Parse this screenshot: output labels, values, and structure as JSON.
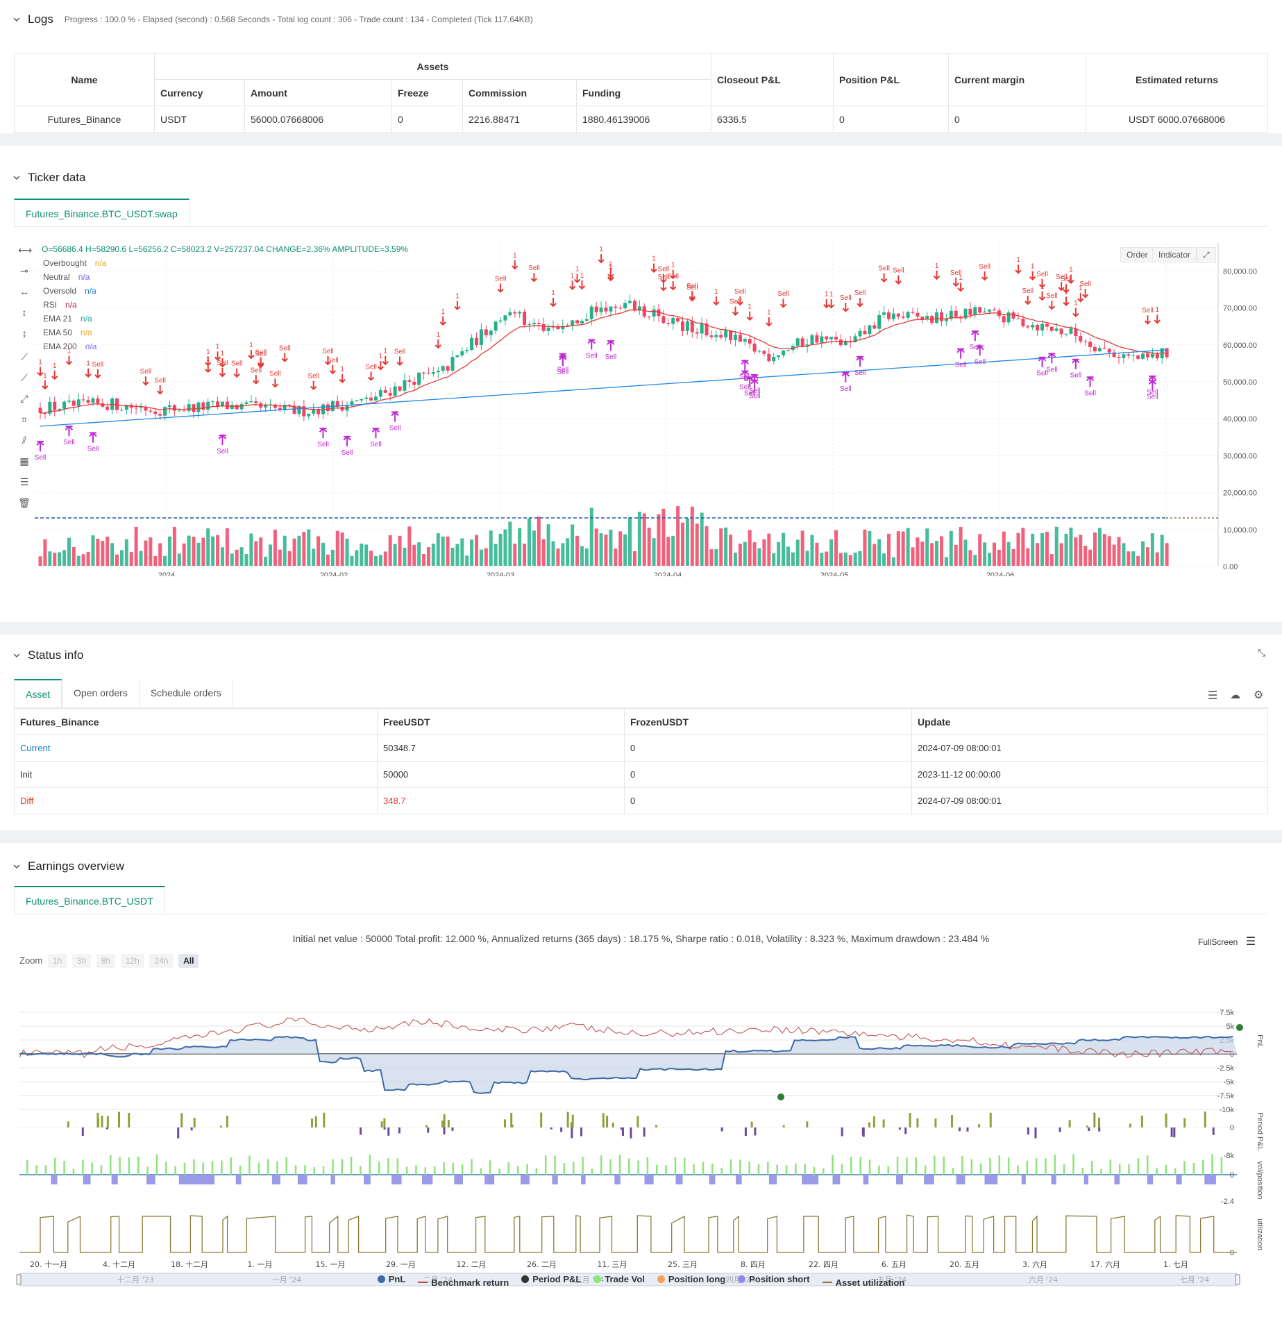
{
  "logs": {
    "title": "Logs",
    "info": "Progress : 100.0 % - Elapsed (second) : 0.568  Seconds - Total log count : 306 - Trade count : 134 - Completed (Tick 117.64KB)"
  },
  "assets_table": {
    "group_header": "Assets",
    "headers": [
      "Name",
      "Currency",
      "Amount",
      "Freeze",
      "Commission",
      "Funding",
      "Closeout P&L",
      "Position P&L",
      "Current margin",
      "Estimated returns"
    ],
    "row": [
      "Futures_Binance",
      "USDT",
      "56000.07668006",
      "0",
      "2216.88471",
      "1880.46139006",
      "6336.5",
      "0",
      "0",
      "USDT 6000.07668006"
    ]
  },
  "ticker": {
    "title": "Ticker data",
    "tab": "Futures_Binance.BTC_USDT.swap",
    "ohlc": "O=56686.4 H=58290.6 L=56256.2 C=58023.2 V=257237.04 CHANGE=2.36% AMPLITUDE=3.59%",
    "legend": [
      {
        "name": "Overbought",
        "value": "n/a",
        "color": "#f5a623"
      },
      {
        "name": "Neutral",
        "value": "n/a",
        "color": "#7b61ff"
      },
      {
        "name": "Oversold",
        "value": "n/a",
        "color": "#1677c9"
      },
      {
        "name": "RSI",
        "value": "n/a",
        "color": "#c0185a"
      },
      {
        "name": "EMA 21",
        "value": "n/a",
        "color": "#26a69a"
      },
      {
        "name": "EMA 50",
        "value": "n/a",
        "color": "#f5a623"
      },
      {
        "name": "EMA 200",
        "value": "n/a",
        "color": "#7b61ff"
      }
    ],
    "order_btn": "Order",
    "indicator_btn": "Indicator",
    "y_ticks": [
      "80,000.00",
      "70,000.00",
      "60,000.00",
      "50,000.00",
      "40,000.00",
      "30,000.00",
      "20,000.00",
      "10,000.00",
      "0.00"
    ],
    "x_ticks": [
      "2024",
      "2024-02",
      "2024-03",
      "2024-04",
      "2024-05",
      "2024-06"
    ],
    "sell_label": "Sell",
    "one_label": "1"
  },
  "status": {
    "title": "Status info",
    "tabs": [
      "Asset",
      "Open orders",
      "Schedule orders"
    ],
    "headers": [
      "Futures_Binance",
      "FreeUSDT",
      "FrozenUSDT",
      "Update"
    ],
    "rows": [
      [
        "Current",
        "50348.7",
        "0",
        "2024-07-09 08:00:01"
      ],
      [
        "Init",
        "50000",
        "0",
        "2023-11-12 00:00:00"
      ],
      [
        "Diff",
        "348.7",
        "0",
        "2024-07-09 08:00:01"
      ]
    ]
  },
  "earnings": {
    "title": "Earnings overview",
    "tab": "Futures_Binance.BTC_USDT",
    "summary": "Initial net value : 50000 Total profit: 12.000 %, Annualized returns (365 days) : 18.175 %, Sharpe ratio : 0.018, Volatility : 8.323 %, Maximum drawdown : 23.484 %",
    "fullscreen": "FullScreen",
    "zoom_label": "Zoom",
    "zoom_options": [
      "1h",
      "3h",
      "8h",
      "12h",
      "24h",
      "All"
    ],
    "pnl_ticks": [
      "7.5k",
      "5k",
      "2.5k",
      "0",
      "-2.5k",
      "-5k",
      "-7.5k",
      "-10k"
    ],
    "period_ticks": [
      "0",
      "-8k"
    ],
    "vol_ticks": [
      "0",
      "-2.4"
    ],
    "util_ticks": [
      "0"
    ],
    "axis_titles": [
      "PnL",
      "Period P&L",
      "vol/position",
      "utilization"
    ],
    "x_ticks": [
      "20. 十一月",
      "4. 十二月",
      "18. 十二月",
      "1. 一月",
      "15. 一月",
      "29. 一月",
      "12. 二月",
      "26. 二月",
      "11. 三月",
      "25. 三月",
      "8. 四月",
      "22. 四月",
      "6. 五月",
      "20. 五月",
      "3. 六月",
      "17. 六月",
      "1. 七月"
    ],
    "nav_ticks": [
      "十二月 '23",
      "一月 '24",
      "二月 '24",
      "三月 '24",
      "四月 '24",
      "五月 '24",
      "六月 '24",
      "七月 '24"
    ],
    "legend": [
      {
        "name": "PnL",
        "color": "#3d6aa8",
        "shape": "dot"
      },
      {
        "name": "Benchmark return",
        "color": "#b94a48",
        "shape": "line"
      },
      {
        "name": "Period P&L",
        "color": "#333333",
        "shape": "dot"
      },
      {
        "name": "Trade Vol",
        "color": "#8ee37a",
        "shape": "dot"
      },
      {
        "name": "Position long",
        "color": "#f5a055",
        "shape": "dot"
      },
      {
        "name": "Position short",
        "color": "#8c8ce6",
        "shape": "dot"
      },
      {
        "name": "Asset utilization",
        "color": "#8a7a3a",
        "shape": "line"
      }
    ]
  }
}
